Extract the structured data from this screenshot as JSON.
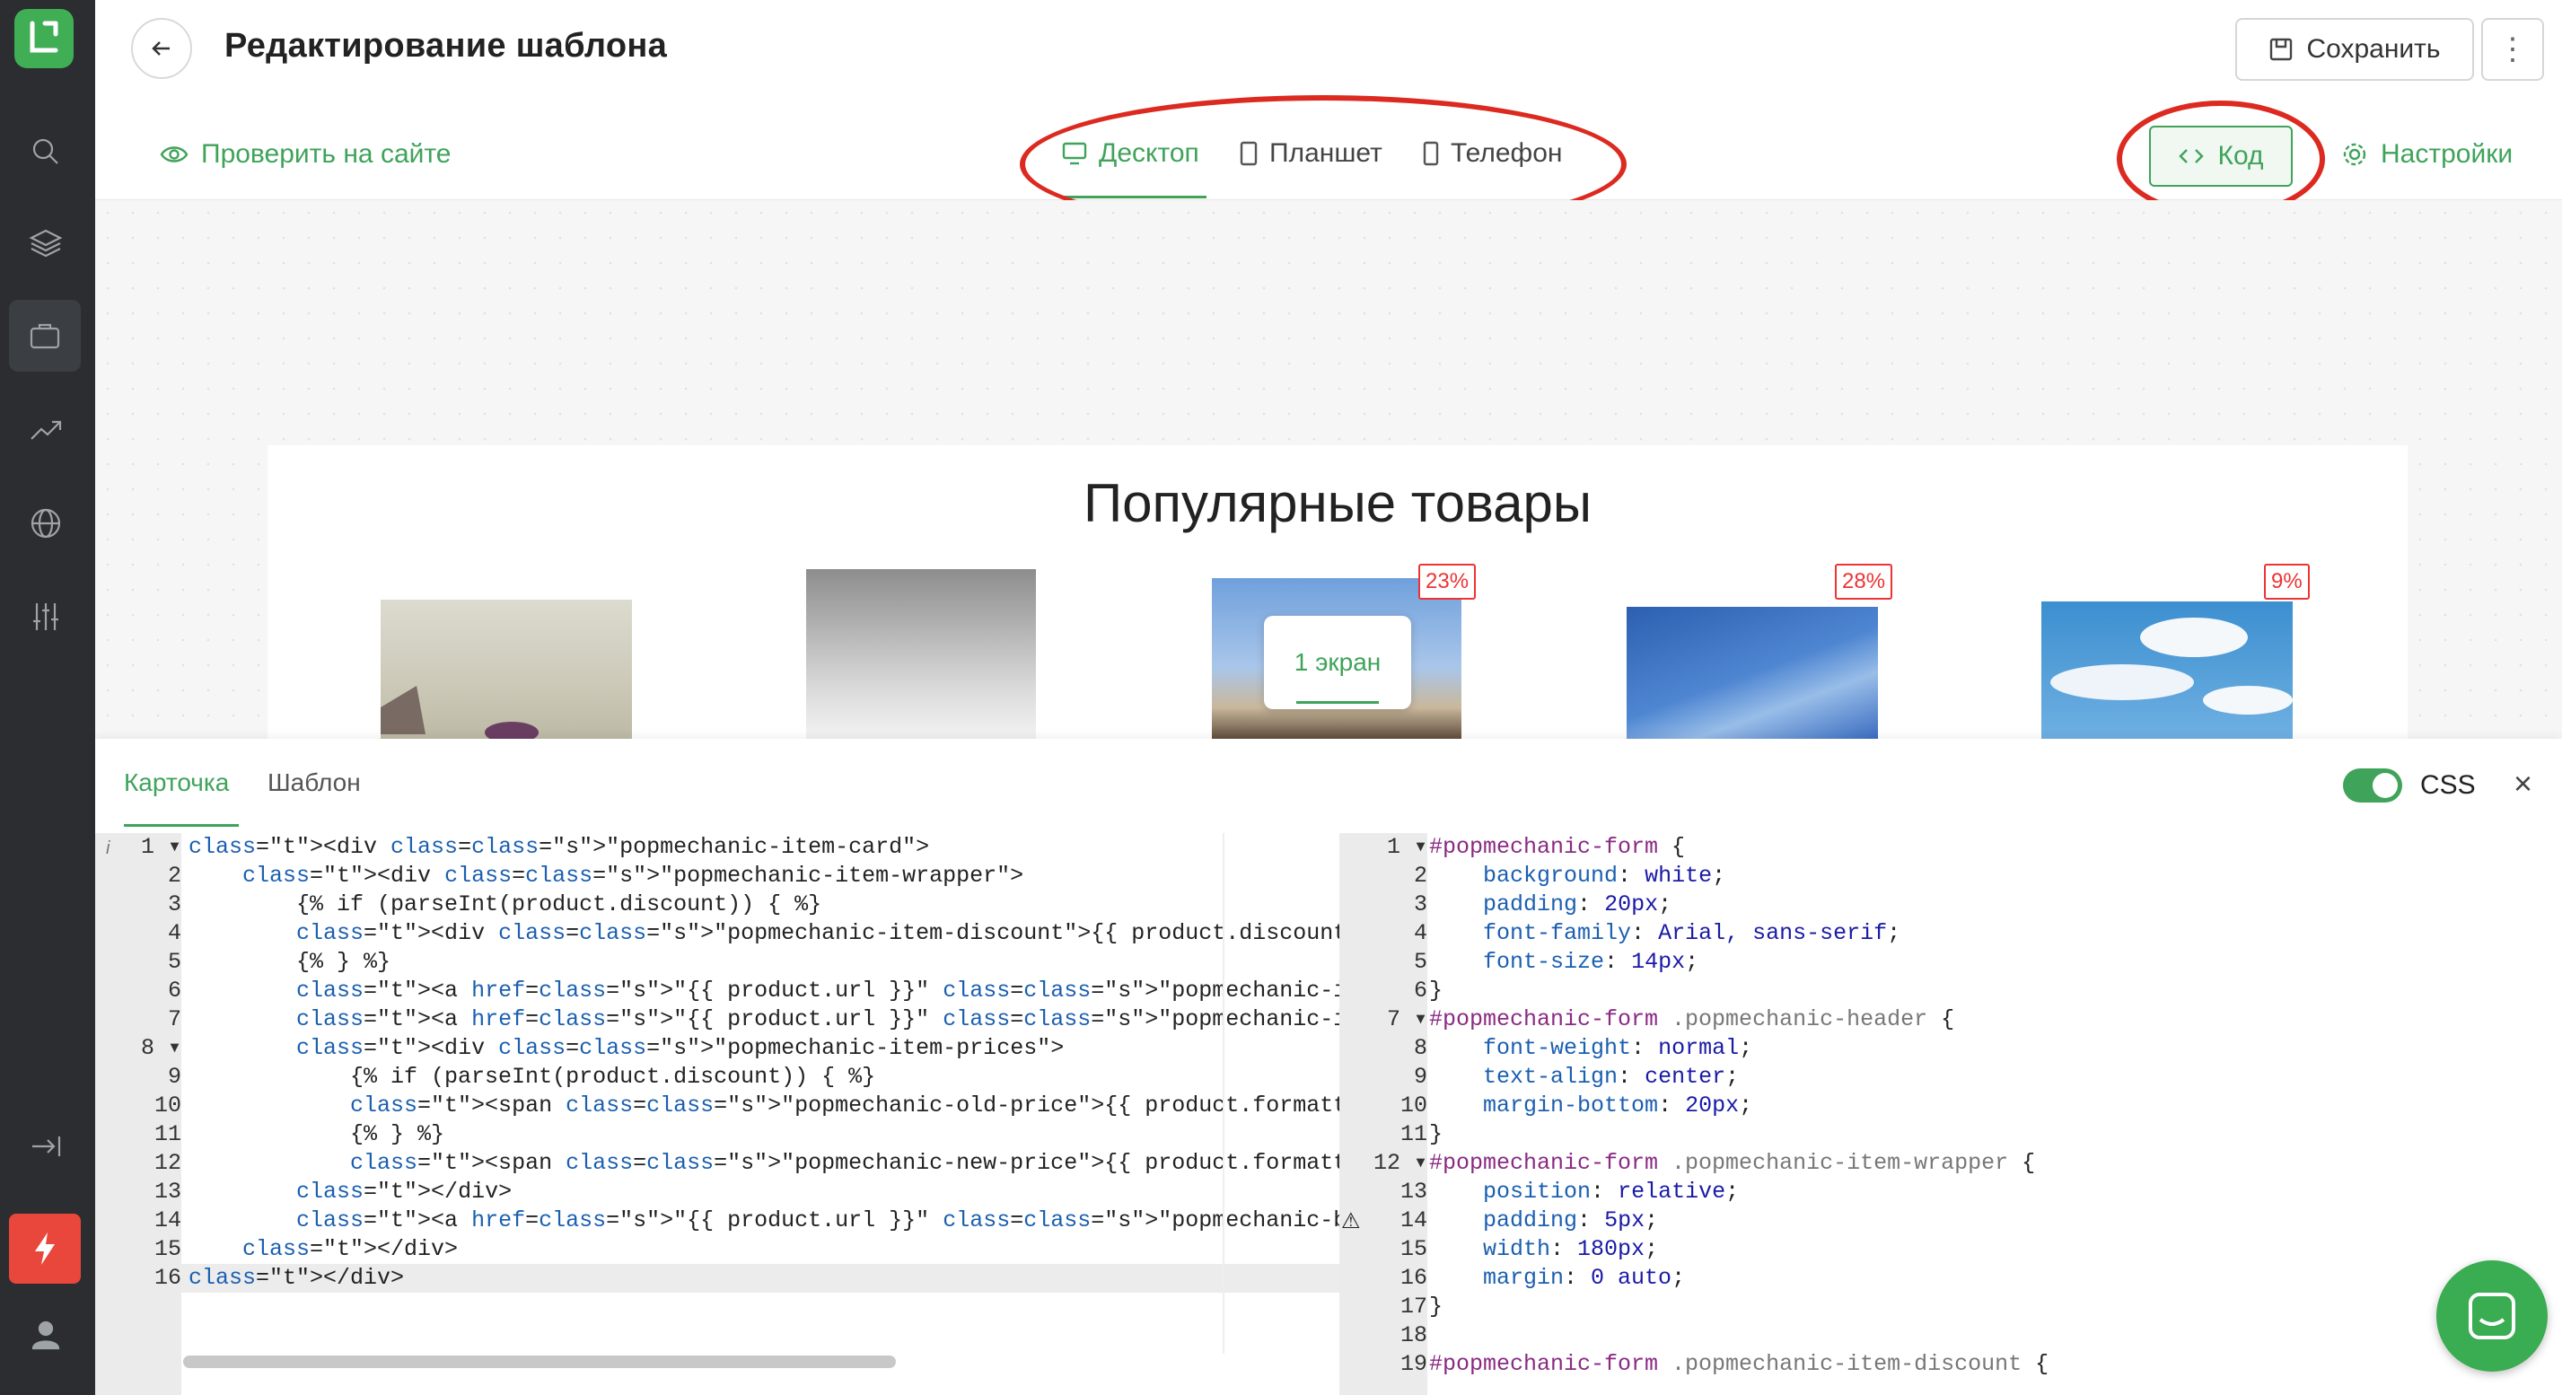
{
  "header": {
    "title": "Редактирование шаблона",
    "save_label": "Сохранить"
  },
  "subbar": {
    "check_site": "Проверить на сайте",
    "devices": [
      {
        "label": "Десктоп"
      },
      {
        "label": "Планшет"
      },
      {
        "label": "Телефон"
      }
    ],
    "code_label": "Код",
    "settings_label": "Настройки"
  },
  "preview": {
    "title": "Популярные товары",
    "discounts": [
      "23%",
      "28%",
      "9%"
    ],
    "screen_pill": "1 экран"
  },
  "panel": {
    "tabs": [
      "Карточка",
      "Шаблон"
    ],
    "css_label": "CSS"
  },
  "html_code_lines": [
    "<div class=\"popmechanic-item-card\">",
    "    <div class=\"popmechanic-item-wrapper\">",
    "        {% if (parseInt(product.discount)) { %}",
    "        <div class=\"popmechanic-item-discount\">{{ product.discount }}</div>",
    "        {% } %}",
    "        <a href=\"{{ product.url }}\" class=\"popmechanic-item-picture\"><img src=\"{{ product",
    "        <a href=\"{{ product.url }}\" class=\"popmechanic-item-name\">{{ product.displayName",
    "        <div class=\"popmechanic-item-prices\">",
    "            {% if (parseInt(product.discount)) { %}",
    "            <span class=\"popmechanic-old-price\">{{ product.formattedOldPrice }}<span clas",
    "            {% } %}",
    "            <span class=\"popmechanic-new-price\">{{ product.formattedPrice }}<span class=\"",
    "        </div>",
    "        <a href=\"{{ product.url }}\" class=\"popmechanic-button\">Подробнее</a>",
    "    </div>",
    "</div>"
  ],
  "css_code_lines": [
    "#popmechanic-form {",
    "    background: white;",
    "    padding: 20px;",
    "    font-family: Arial, sans-serif;",
    "    font-size: 14px;",
    "}",
    "#popmechanic-form .popmechanic-header {",
    "    font-weight: normal;",
    "    text-align: center;",
    "    margin-bottom: 20px;",
    "}",
    "#popmechanic-form .popmechanic-item-wrapper {",
    "    position: relative;",
    "    padding: 5px;",
    "    width: 180px;",
    "    margin: 0 auto;",
    "}",
    "",
    "#popmechanic-form .popmechanic-item-discount {"
  ],
  "colors": {
    "accent": "#3fa35a",
    "highlight": "#dc2a20",
    "sidebar": "#2b2d30",
    "flash": "#e9473b"
  }
}
